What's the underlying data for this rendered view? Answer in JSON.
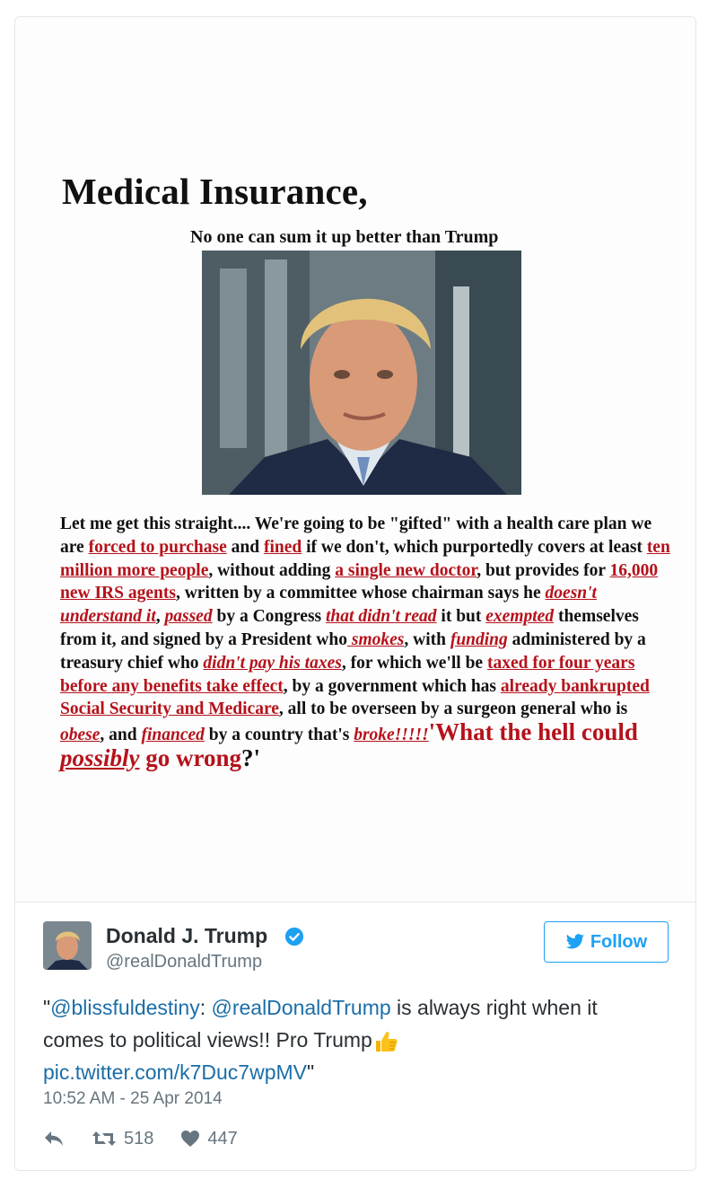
{
  "media": {
    "title": "Medical Insurance,",
    "subtitle": "No one can sum it up better than Trump",
    "body": {
      "t1": "Let me get this straight.... We're going to be \"gifted\" with a health care plan we are ",
      "r1": "forced to purchase",
      "t2": " and ",
      "r2": "fined",
      "t3": " if we don't, which purportedly covers at least ",
      "r3": "ten million more people",
      "t4": ", without adding ",
      "r4": "a single new doctor",
      "t5": ", but provides for ",
      "r5": "16,000 new IRS agents",
      "t6": ", written by a committee whose chairman says he ",
      "r6": "doesn't understand it",
      "t7": ", ",
      "r7": "passed",
      "t8": " by a Congress ",
      "r8": "that didn't read",
      "t9": " it but ",
      "r9": "exempted",
      "t10": " themselves from it, and signed by a President who",
      "r10": " smokes",
      "t11": ", with ",
      "r11": "funding",
      "t12": " administered by a treasury chief who ",
      "r12": "didn't pay his taxes",
      "t13": ", for which we'll be ",
      "r13": "taxed for four years before any benefits take effect",
      "t14": ", by a government which has ",
      "r14": "already bankrupted Social Security and Medicare",
      "t15": ", all to be overseen by a surgeon general who is ",
      "r15": "obese",
      "t16": ", and ",
      "r16": "financed",
      "t17": " by a country that's ",
      "r17": "broke!!!!!",
      "q1": "'What the hell could ",
      "q2": "possibly",
      "q3": " go wrong",
      "q4": "?'"
    }
  },
  "user": {
    "name": "Donald J. Trump",
    "handle": "@realDonaldTrump",
    "verified_icon": "verified-badge-icon"
  },
  "follow_button": {
    "label": "Follow",
    "icon": "twitter-bird-icon"
  },
  "tweet": {
    "quote_open": "\"",
    "mention1": "@blissfuldestiny",
    "sep": ": ",
    "mention2": "@realDonaldTrump",
    "text": " is always right when it comes to political views!! Pro Trump",
    "emoji": "thumbs-up-icon",
    "link": "pic.twitter.com/k7Duc7wpMV",
    "quote_close": "\""
  },
  "timestamp": "10:52 AM - 25 Apr 2014",
  "actions": {
    "reply_icon": "reply-icon",
    "retweet_icon": "retweet-icon",
    "retweet_count": "518",
    "like_icon": "heart-icon",
    "like_count": "447"
  },
  "colors": {
    "link": "#1b6ea8",
    "accent": "#1da1f2",
    "red_text": "#b5121b"
  }
}
